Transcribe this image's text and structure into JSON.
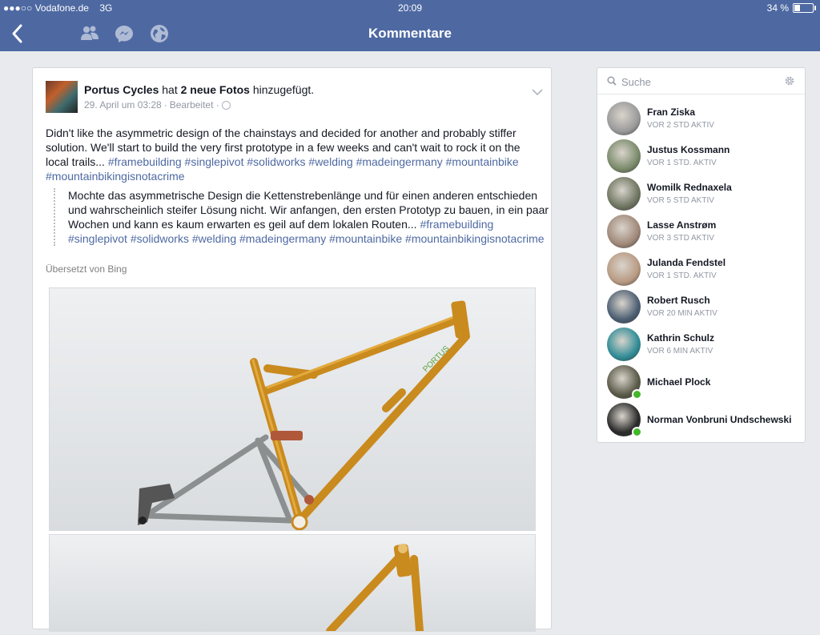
{
  "status_bar": {
    "carrier": "●●●○○ Vodafone.de",
    "network": "3G",
    "time": "20:09",
    "battery": "34 %",
    "battery_level": 0.34
  },
  "nav": {
    "title": "Kommentare",
    "icons": [
      "back-chevron-icon",
      "friends-icon",
      "messenger-icon",
      "globe-icon"
    ]
  },
  "post": {
    "page_name": "Portus Cycles",
    "action_pre": "hat",
    "action_bold": "2 neue Fotos",
    "action_post": "hinzugefügt.",
    "date": "29. April um 03:28",
    "edited": "Bearbeitet ·",
    "text": "Didn't like the asymmetric design of the chainstays and decided for another and probably stiffer solution. We'll start to build the very first prototype in a few weeks and can't wait to rock it on the local trails...",
    "hashtags": [
      "#framebuilding",
      "#singlepivot",
      "#solidworks",
      "#welding",
      "#madeingermany",
      "#mountainbike",
      "#mountainbikingisnotacrime"
    ],
    "translation": "Mochte das asymmetrische Design die Kettenstrebenlänge und für einen anderen entschieden und wahrscheinlich steifer Lösung nicht. Wir anfangen, den ersten Prototyp zu bauen, in ein paar Wochen und kann es kaum erwarten es geil auf dem lokalen Routen...",
    "translation_hashtags": [
      "#framebuilding",
      "#singlepivot",
      "#solidworks",
      "#welding",
      "#madeingermany",
      "#mountainbike",
      "#mountainbikingisnotacrime"
    ],
    "translated_by": "Übersetzt von Bing"
  },
  "chat": {
    "search_placeholder": "Suche",
    "friends": [
      {
        "name": "Fran Ziska",
        "status": "VOR 2 STD AKTIV",
        "online": false,
        "color": "#9a9a9a"
      },
      {
        "name": "Justus Kossmann",
        "status": "VOR 1 STD. AKTIV",
        "online": false,
        "color": "#7a8a6a"
      },
      {
        "name": "Womilk Rednaxela",
        "status": "VOR 5 STD AKTIV",
        "online": false,
        "color": "#6e7560"
      },
      {
        "name": "Lasse Anstrøm",
        "status": "VOR 3 STD AKTIV",
        "online": false,
        "color": "#a08878"
      },
      {
        "name": "Julanda Fendstel",
        "status": "VOR 1 STD. AKTIV",
        "online": false,
        "color": "#b89a82"
      },
      {
        "name": "Robert Rusch",
        "status": "VOR 20 MIN AKTIV",
        "online": false,
        "color": "#4c5e72"
      },
      {
        "name": "Kathrin Schulz",
        "status": "VOR 6 MIN AKTIV",
        "online": false,
        "color": "#2f8c96"
      },
      {
        "name": "Michael Plock",
        "status": "",
        "online": true,
        "color": "#5a5a48"
      },
      {
        "name": "Norman Vonbruni Undschewski",
        "status": "",
        "online": true,
        "color": "#2a2a2a"
      }
    ]
  }
}
